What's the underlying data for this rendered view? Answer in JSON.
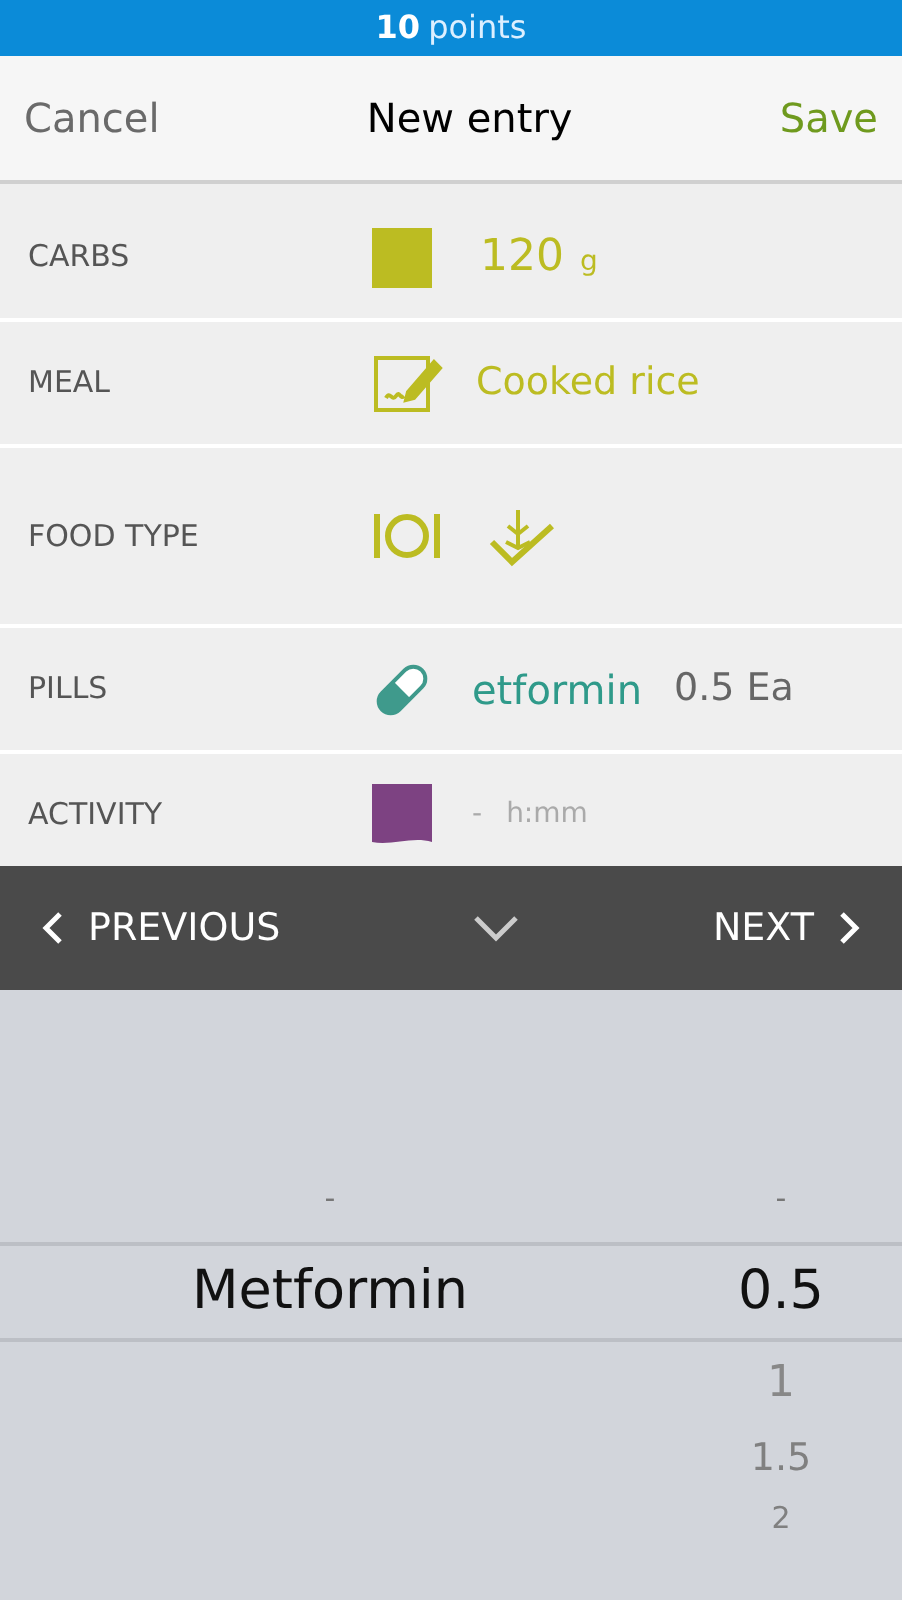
{
  "points_bar": {
    "count": "10",
    "label": "points"
  },
  "nav": {
    "cancel": "Cancel",
    "title": "New entry",
    "save": "Save"
  },
  "rows": [
    {
      "kind": "amount",
      "label": "CARBS",
      "value": "120",
      "unit": "g"
    },
    {
      "kind": "text",
      "label": "MEAL",
      "value": "Cooked rice"
    },
    {
      "kind": "icons",
      "label": "FOOD TYPE"
    },
    {
      "kind": "pill",
      "label": "PILLS",
      "value": "etformin",
      "amount": "0.5 Ea"
    },
    {
      "kind": "duration",
      "label": "ACTIVITY",
      "dash": "-",
      "placeholder": "h:mm"
    }
  ],
  "toolbar": {
    "previous": "PREVIOUS",
    "next": "NEXT"
  },
  "picker": {
    "columns": [
      {
        "items": [
          {
            "text": "-",
            "selected": false
          },
          {
            "text": "Metformin",
            "selected": true
          }
        ]
      },
      {
        "items": [
          {
            "text": "-",
            "selected": false
          },
          {
            "text": "0.5",
            "selected": true
          },
          {
            "text": "1",
            "selected": false
          },
          {
            "text": "1.5",
            "selected": false
          },
          {
            "text": "2",
            "selected": false
          }
        ]
      }
    ]
  }
}
